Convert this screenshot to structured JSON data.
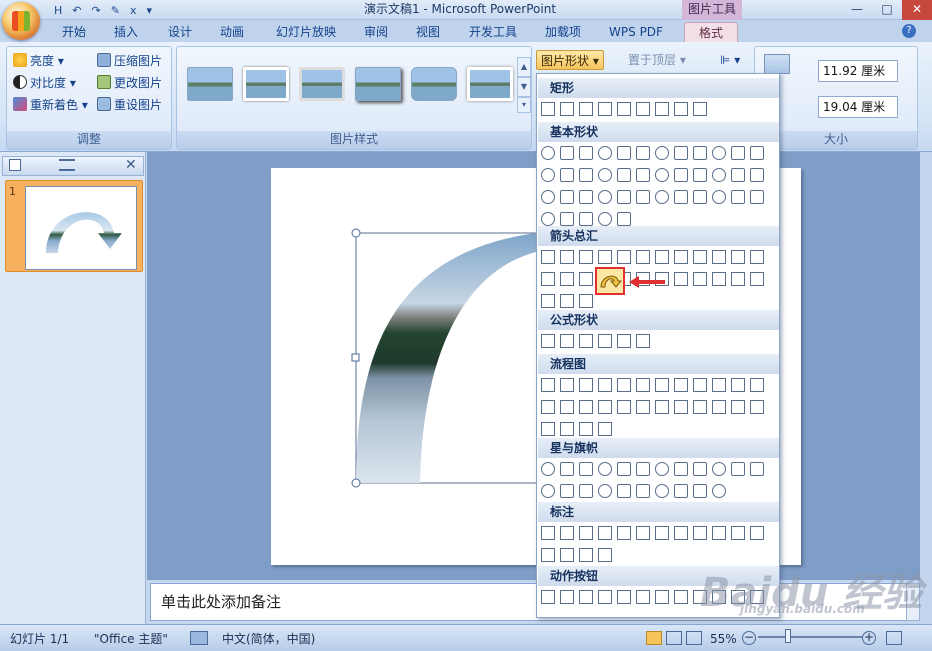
{
  "window": {
    "title": "演示文稿1 - Microsoft PowerPoint",
    "contextual_tab_group": "图片工具",
    "controls": [
      "—",
      "□",
      "✕"
    ]
  },
  "quick_access": [
    "H",
    "↶",
    "↷",
    "✎",
    "x",
    "▾"
  ],
  "tabs": [
    {
      "label": "开始"
    },
    {
      "label": "插入"
    },
    {
      "label": "设计"
    },
    {
      "label": "动画"
    },
    {
      "label": "幻灯片放映"
    },
    {
      "label": "审阅"
    },
    {
      "label": "视图"
    },
    {
      "label": "开发工具"
    },
    {
      "label": "加载项"
    },
    {
      "label": "WPS PDF"
    },
    {
      "label": "格式",
      "active": true
    }
  ],
  "ribbon": {
    "adjust": {
      "title": "调整",
      "brightness": "亮度",
      "contrast": "对比度",
      "recolor": "重新着色",
      "compress": "压缩图片",
      "change": "更改图片",
      "reset": "重设图片"
    },
    "picture_styles": {
      "title": "图片样式"
    },
    "picture_shape": "图片形状",
    "bring_front": "置于顶层",
    "size": {
      "title": "大小",
      "height": "11.92 厘米",
      "width": "19.04 厘米"
    }
  },
  "left_panel": {
    "slide_number": "1"
  },
  "shape_menu": {
    "categories": [
      {
        "name": "矩形"
      },
      {
        "name": "基本形状"
      },
      {
        "name": "箭头总汇"
      },
      {
        "name": "公式形状"
      },
      {
        "name": "流程图"
      },
      {
        "name": "星与旗帜"
      },
      {
        "name": "标注"
      },
      {
        "name": "动作按钮"
      }
    ]
  },
  "notes_placeholder": "单击此处添加备注",
  "status": {
    "slide": "幻灯片 1/1",
    "theme": "\"Office 主题\"",
    "language": "中文(简体，中国)",
    "zoom": "55%"
  },
  "watermark": {
    "brand": "Baidu 经验",
    "url": "jingyan.baidu.com"
  },
  "colors": {
    "accent": "#15428b",
    "highlight": "#e03030",
    "ribbon": "#d5e4f6"
  }
}
